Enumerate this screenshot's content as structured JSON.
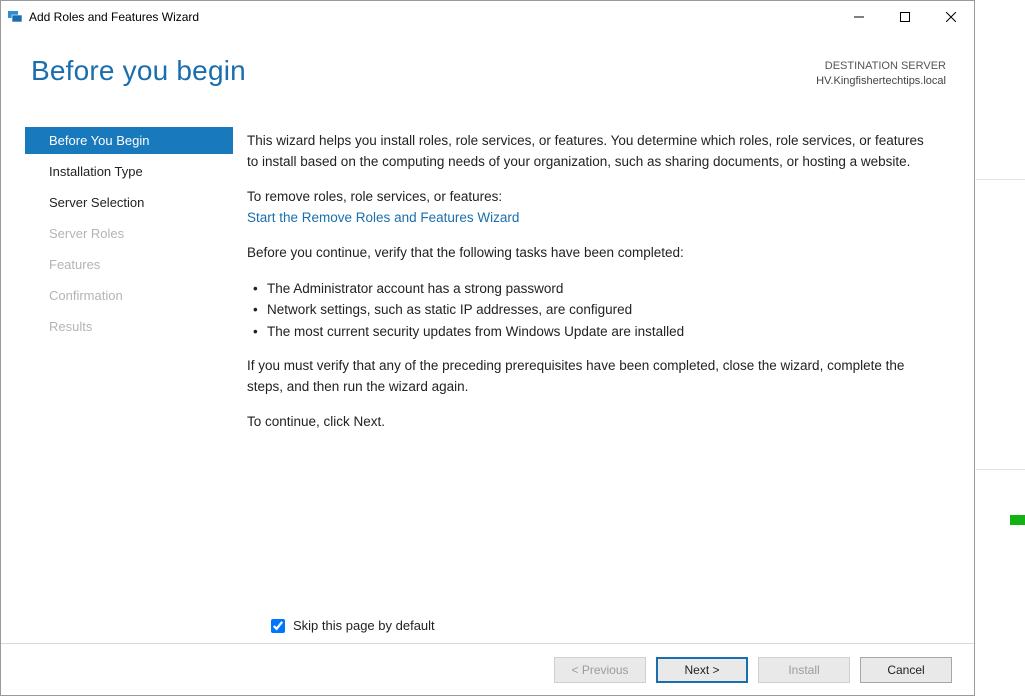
{
  "window": {
    "title": "Add Roles and Features Wizard"
  },
  "header": {
    "page_title": "Before you begin",
    "destination_label": "DESTINATION SERVER",
    "destination_value": "HV.Kingfishertechtips.local"
  },
  "sidebar": {
    "items": [
      {
        "label": "Before You Begin",
        "state": "active"
      },
      {
        "label": "Installation Type",
        "state": "enabled"
      },
      {
        "label": "Server Selection",
        "state": "enabled"
      },
      {
        "label": "Server Roles",
        "state": "disabled"
      },
      {
        "label": "Features",
        "state": "disabled"
      },
      {
        "label": "Confirmation",
        "state": "disabled"
      },
      {
        "label": "Results",
        "state": "disabled"
      }
    ]
  },
  "content": {
    "intro": "This wizard helps you install roles, role services, or features. You determine which roles, role services, or features to install based on the computing needs of your organization, such as sharing documents, or hosting a website.",
    "remove_lead": "To remove roles, role services, or features:",
    "remove_link": "Start the Remove Roles and Features Wizard",
    "verify_lead": "Before you continue, verify that the following tasks have been completed:",
    "bullets": [
      "The Administrator account has a strong password",
      "Network settings, such as static IP addresses, are configured",
      "The most current security updates from Windows Update are installed"
    ],
    "if_must": "If you must verify that any of the preceding prerequisites have been completed, close the wizard, complete the steps, and then run the wizard again.",
    "to_continue": "To continue, click Next.",
    "skip_label": "Skip this page by default",
    "skip_checked": true
  },
  "footer": {
    "previous": "< Previous",
    "next": "Next >",
    "install": "Install",
    "cancel": "Cancel"
  }
}
